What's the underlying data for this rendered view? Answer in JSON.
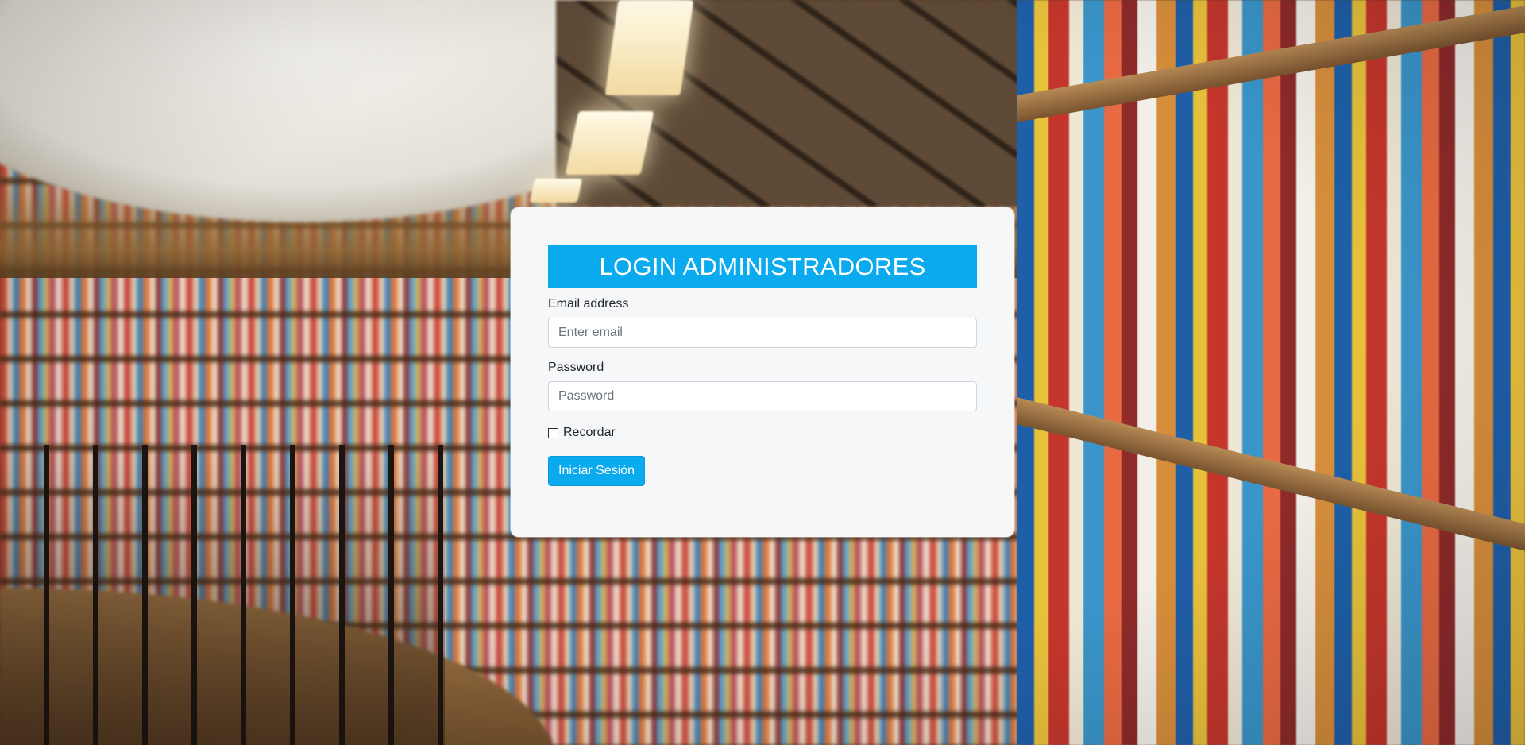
{
  "login": {
    "title": "LOGIN ADMINISTRADORES",
    "email": {
      "label": "Email address",
      "placeholder": "Enter email",
      "value": ""
    },
    "password": {
      "label": "Password",
      "placeholder": "Password",
      "value": ""
    },
    "remember_label": "Recordar",
    "remember_checked": false,
    "submit_label": "Iniciar Sesión"
  },
  "colors": {
    "accent": "#0aaaee",
    "card_background": "#f6f7f9"
  },
  "background": {
    "description_icon": "library-bookshelves-photo"
  }
}
